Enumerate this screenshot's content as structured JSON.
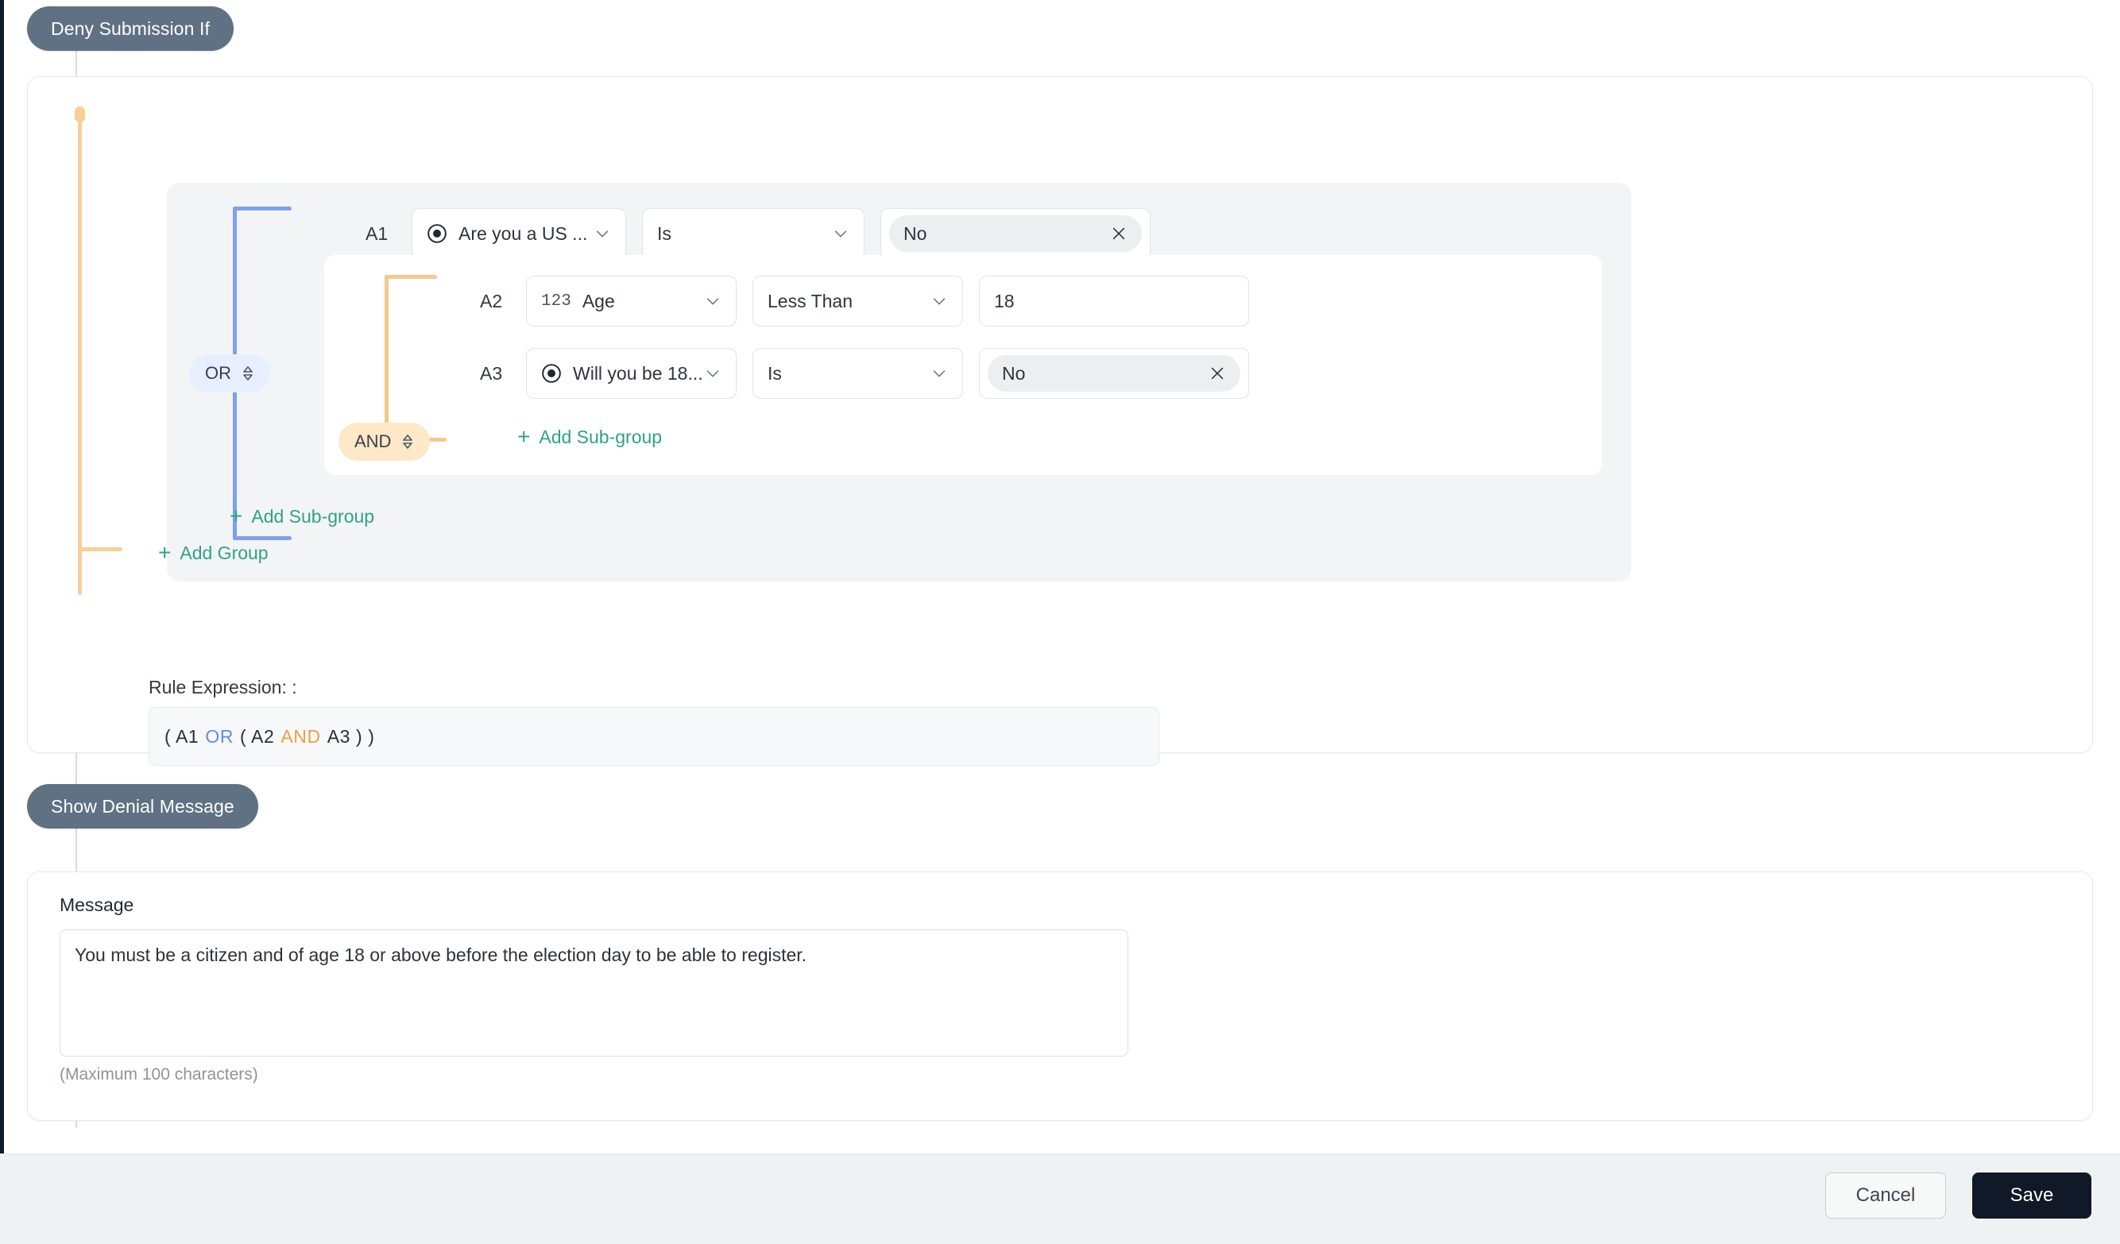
{
  "flow": {
    "deny_pill": "Deny Submission If",
    "show_pill": "Show Denial Message"
  },
  "group": {
    "operator": "OR",
    "add_group_label": "Add Group",
    "add_subgroup_label": "Add Sub-group",
    "conditions": [
      {
        "tag": "A1",
        "field": "Are you a US ...",
        "field_icon": "radio-icon",
        "operator": "Is",
        "value": "No",
        "value_type": "chip"
      }
    ]
  },
  "subgroup": {
    "operator": "AND",
    "add_subgroup_label": "Add Sub-group",
    "conditions": [
      {
        "tag": "A2",
        "field": "Age",
        "field_icon": "number-icon",
        "field_icon_text": "123",
        "operator": "Less Than",
        "value": "18",
        "value_type": "text"
      },
      {
        "tag": "A3",
        "field": "Will you be 18...",
        "field_icon": "radio-icon",
        "operator": "Is",
        "value": "No",
        "value_type": "chip"
      }
    ]
  },
  "rule": {
    "label": "Rule Expression: :",
    "expression_tokens": [
      "(",
      "A1",
      "OR",
      "(",
      "A2",
      "AND",
      "A3",
      ")",
      ")"
    ],
    "expression_text": "( A1 OR ( A2 AND A3 ) )",
    "parts": {
      "p1": "( A1",
      "or": "OR",
      "p2": "( A2",
      "and": "AND",
      "p3": "A3 ) )"
    }
  },
  "message": {
    "label": "Message",
    "value": "You must be a citizen and of age 18 or above before the election day to be able to register.",
    "placeholder": "",
    "hint": "(Maximum 100 characters)"
  },
  "footer": {
    "cancel_label": "Cancel",
    "save_label": "Save"
  },
  "colors": {
    "pill": "#5f7183",
    "or_line": "#7da2e8",
    "and_line": "#f5c88f",
    "group_line": "#f8ce99",
    "link": "#2fa383",
    "save_bg": "#111827"
  }
}
